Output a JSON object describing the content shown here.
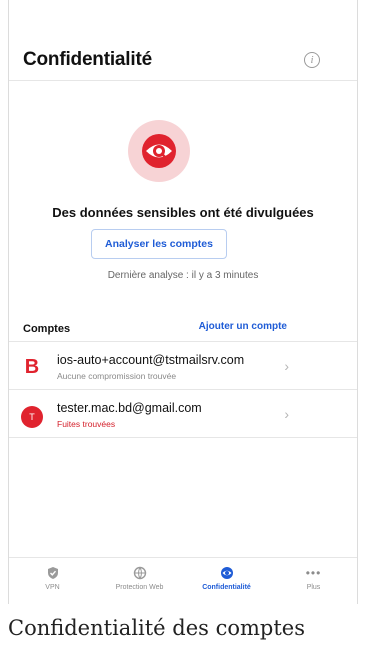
{
  "header": {
    "title": "Confidentialité",
    "info_icon": "info-icon"
  },
  "hero": {
    "icon": "privacy-eye-icon",
    "title": "Des données sensibles ont été divulguées",
    "scan_button": "Analyser les comptes",
    "last_scan": "Dernière analyse : il y a 3 minutes"
  },
  "accounts": {
    "label": "Comptes",
    "add_label": "Ajouter un compte",
    "items": [
      {
        "avatar": "B",
        "email": "ios-auto+account@tstmailsrv.com",
        "status": "Aucune compromission trouvée",
        "alert": false
      },
      {
        "avatar": "T",
        "email": "tester.mac.bd@gmail.com",
        "status": "Fuites trouvées",
        "alert": true
      }
    ]
  },
  "tabbar": {
    "tabs": [
      {
        "label": "VPN",
        "icon": "shield-icon",
        "active": false
      },
      {
        "label": "Protection Web",
        "icon": "web-protection-icon",
        "active": false
      },
      {
        "label": "Confidentialité",
        "icon": "privacy-eye-icon",
        "active": true
      },
      {
        "label": "Plus",
        "icon": "more-dots-icon",
        "active": false
      }
    ]
  },
  "caption": "Confidentialité des comptes",
  "colors": {
    "accent": "#1f5cd6",
    "alert": "#e0232e",
    "hero_bg": "#f7d3d5"
  }
}
